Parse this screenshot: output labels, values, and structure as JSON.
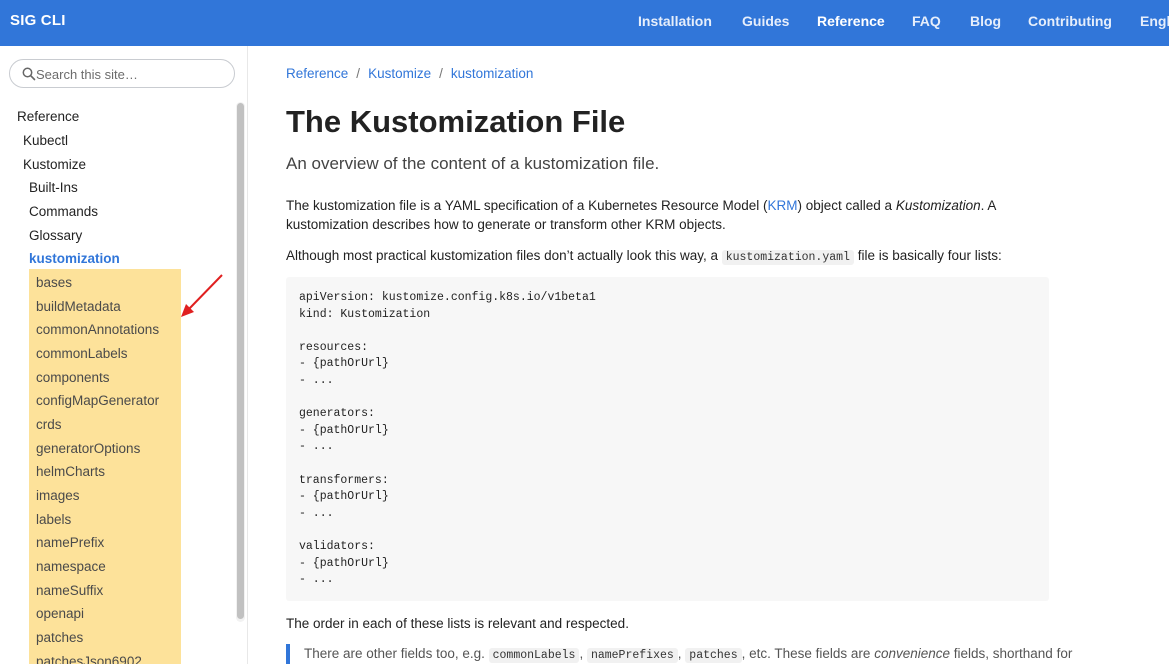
{
  "navbar": {
    "brand": "SIG CLI",
    "links": [
      "Installation",
      "Guides",
      "Reference",
      "FAQ",
      "Blog",
      "Contributing",
      "Engl"
    ]
  },
  "sidebar": {
    "search_placeholder": "Search this site…",
    "tree": [
      "Reference",
      "Kubectl",
      "Kustomize",
      "Built-Ins",
      "Commands",
      "Glossary",
      "kustomization"
    ],
    "subitems": [
      "bases",
      "buildMetadata",
      "commonAnnotations",
      "commonLabels",
      "components",
      "configMapGenerator",
      "crds",
      "generatorOptions",
      "helmCharts",
      "images",
      "labels",
      "namePrefix",
      "namespace",
      "nameSuffix",
      "openapi",
      "patches",
      "patchesJson6902"
    ],
    "highlight_color": "#fde29a",
    "arrow_color": "#e02020"
  },
  "breadcrumb": [
    "Reference",
    "Kustomize",
    "kustomization"
  ],
  "page": {
    "title": "The Kustomization File",
    "lead": "An overview of the content of a kustomization file.",
    "p1_a": "The kustomization file is a YAML specification of a Kubernetes Resource Model (",
    "p1_link": "KRM",
    "p1_b": ") object called a ",
    "p1_em": "Kustomization",
    "p1_c": ". A kustomization describes how to generate or transform other KRM objects.",
    "p2_a": "Although most practical kustomization files don’t actually look this way, a ",
    "p2_code": "kustomization.yaml",
    "p2_b": " file is basically four lists:",
    "code": "apiVersion: kustomize.config.k8s.io/v1beta1\nkind: Kustomization\n\nresources:\n- {pathOrUrl}\n- ...\n\ngenerators:\n- {pathOrUrl}\n- ...\n\ntransformers:\n- {pathOrUrl}\n- ...\n\nvalidators:\n- {pathOrUrl}\n- ...",
    "p3": "The order in each of these lists is relevant and respected.",
    "bq_a": "There are other fields too, e.g. ",
    "bq_code1": "commonLabels",
    "bq_code2": "namePrefixes",
    "bq_code3": "patches",
    "bq_b": ", etc. These fields are ",
    "bq_em": "convenience",
    "bq_c": " fields, shorthand for",
    "comma": ", "
  },
  "colors": {
    "accent": "#3176d9",
    "navbar": "#3176d9"
  }
}
